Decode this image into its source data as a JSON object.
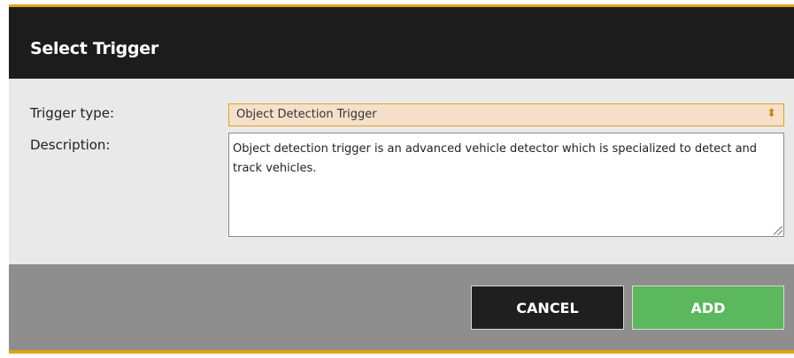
{
  "dialog": {
    "title": "Select Trigger"
  },
  "form": {
    "trigger_type_label": "Trigger type:",
    "trigger_type_value": "Object Detection Trigger",
    "description_label": "Description:",
    "description_value": "Object detection trigger is an advanced vehicle detector which is specialized to detect and track vehicles."
  },
  "buttons": {
    "cancel": "CANCEL",
    "add": "ADD"
  },
  "icons": {
    "select_chevron": "⬍"
  },
  "colors": {
    "accent": "#e0a21b",
    "header_bg": "#1c1c1c",
    "select_bg": "#f7e0cb",
    "add_button": "#5cb85c",
    "cancel_button": "#1f1f1f",
    "footer_bg": "#8e8e8e"
  }
}
